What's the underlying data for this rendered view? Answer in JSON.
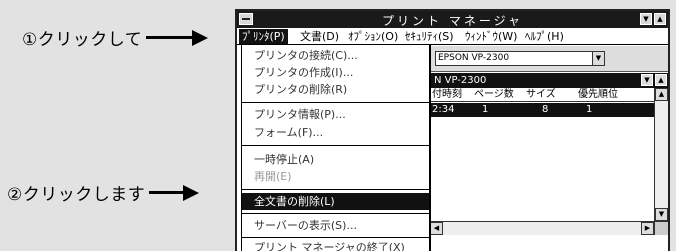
{
  "annotations": {
    "step1": "①クリックして",
    "step2": "②クリックします"
  },
  "window": {
    "title": "プリント マネージャ",
    "minimize_glyph": "▼",
    "maximize_glyph": "▲"
  },
  "menubar": {
    "items": [
      {
        "label": "ﾌﾟﾘﾝﾀ(P)"
      },
      {
        "label": "文書(D)"
      },
      {
        "label": "ｵﾌﾟｼｮﾝ(O)"
      },
      {
        "label": "ｾｷｭﾘﾃｨ(S)"
      },
      {
        "label": "ｳｨﾝﾄﾞｳ(W)"
      },
      {
        "label": "ﾍﾙﾌﾟ(H)"
      }
    ]
  },
  "dropdown": {
    "items": [
      {
        "label": "プリンタの接続(C)..."
      },
      {
        "label": "プリンタの作成(I)..."
      },
      {
        "label": "プリンタの削除(R)"
      },
      {
        "label": "プリンタ情報(P)..."
      },
      {
        "label": "フォーム(F)..."
      },
      {
        "label": "一時停止(A)"
      },
      {
        "label": "再開(E)"
      },
      {
        "label": "全文書の削除(L)"
      },
      {
        "label": "サーバーの表示(S)..."
      },
      {
        "label": "プリント マネージャの終了(X)"
      }
    ]
  },
  "toolbar": {
    "printer_combo_value": "EPSON VP-2300",
    "combo_arrow": "▼"
  },
  "queue_window": {
    "title": "N VP-2300",
    "columns": [
      "付時刻",
      "ページ数",
      "サイズ",
      "優先順位"
    ],
    "row": [
      "2:34",
      "1",
      "8",
      "1"
    ]
  },
  "scroll": {
    "up": "▲",
    "down": "▼",
    "left": "◀",
    "right": "▶"
  }
}
